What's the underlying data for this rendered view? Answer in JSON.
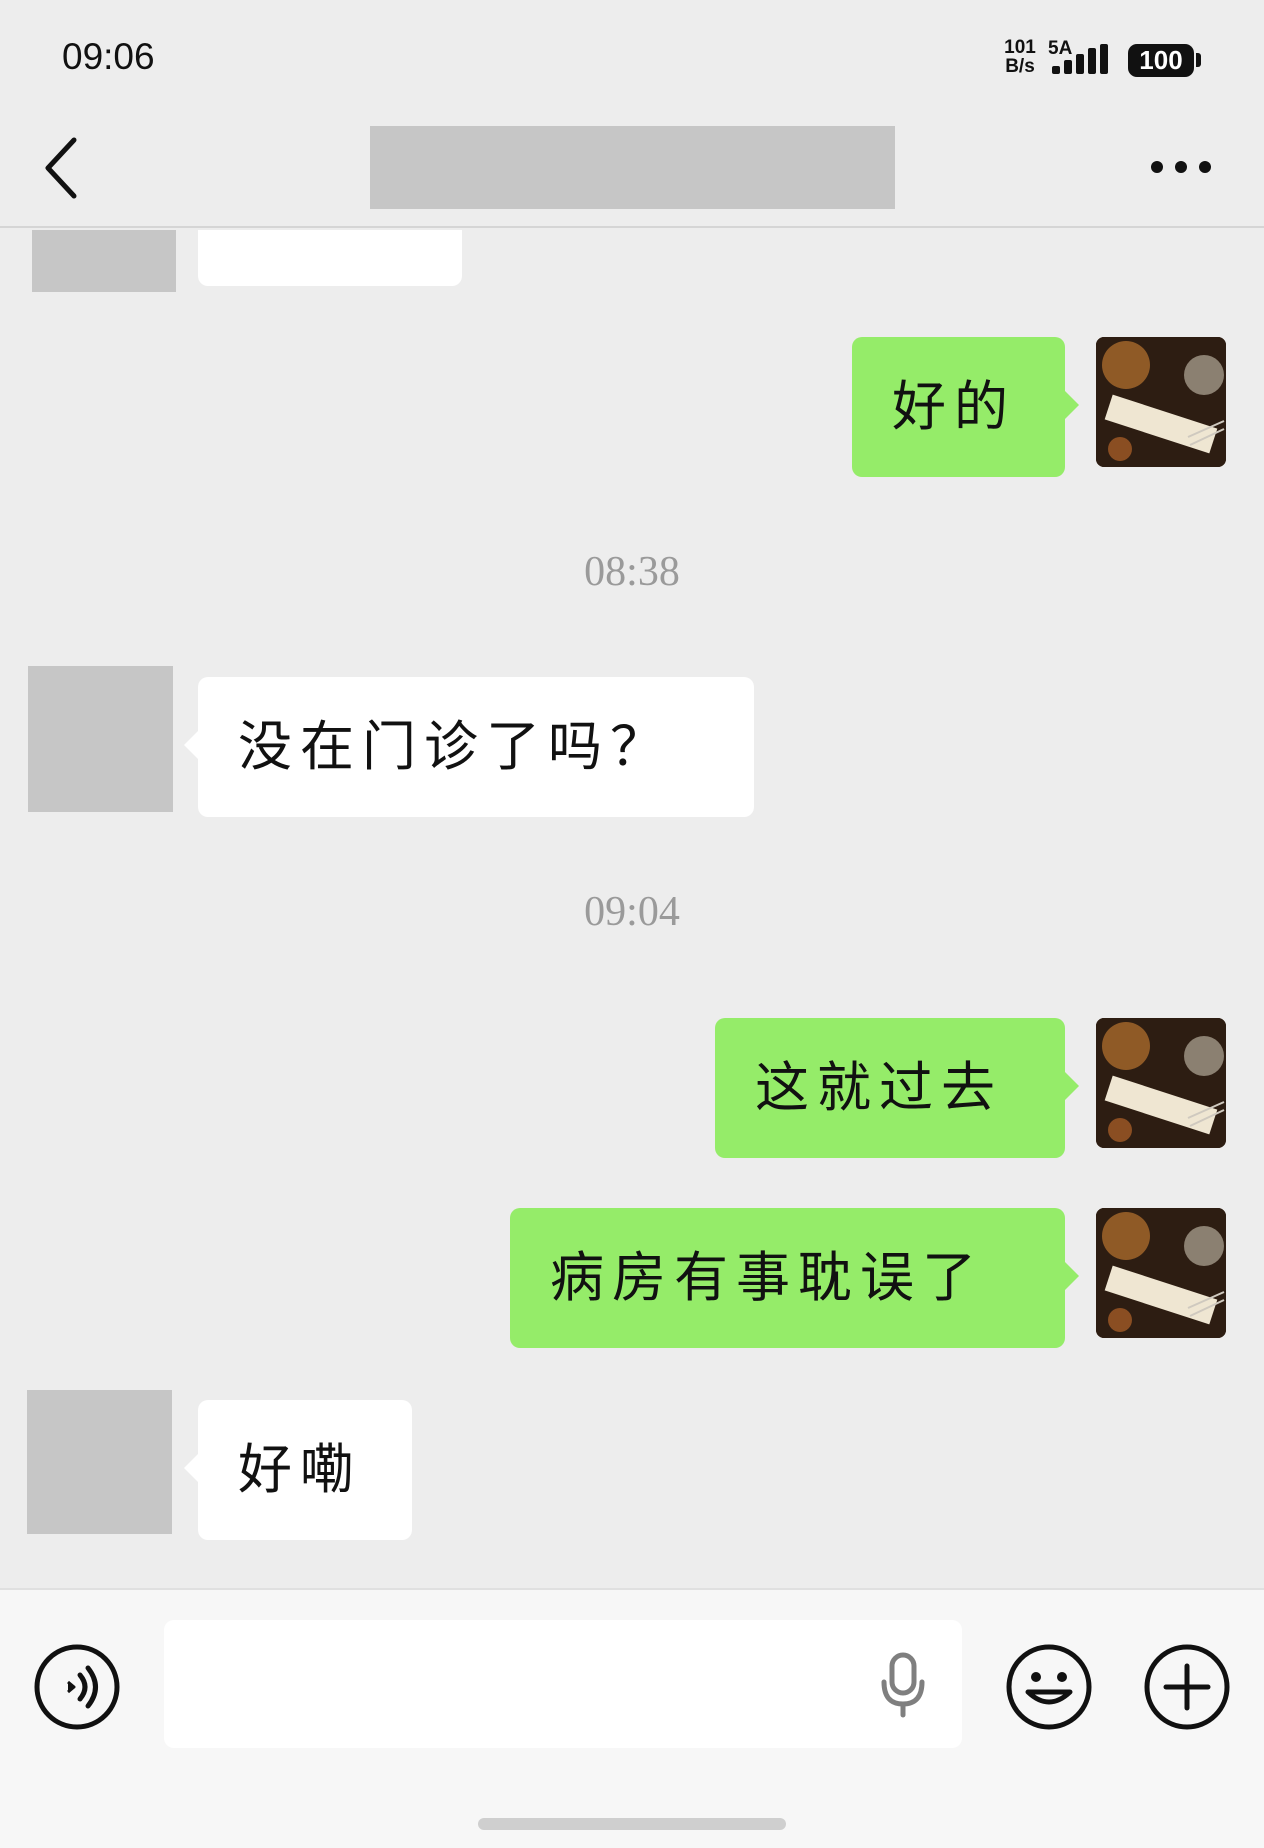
{
  "status_bar": {
    "time": "09:06",
    "net_speed_value": "101",
    "net_speed_unit": "B/s",
    "network": "5A",
    "battery": "100"
  },
  "nav": {
    "back_icon": "chevron-left-icon",
    "more_icon": "more-dots-icon",
    "title": ""
  },
  "messages": [
    {
      "side": "in",
      "text": ""
    },
    {
      "side": "out",
      "text": "好的"
    },
    {
      "type": "timestamp",
      "text": "08:38"
    },
    {
      "side": "in",
      "text": "没在门诊了吗？"
    },
    {
      "type": "timestamp",
      "text": "09:04"
    },
    {
      "side": "out",
      "text": "这就过去"
    },
    {
      "side": "out",
      "text": "病房有事耽误了"
    },
    {
      "side": "in",
      "text": "好嘞"
    }
  ],
  "input_bar": {
    "voice_icon": "voice-toggle-icon",
    "placeholder": "",
    "mic_icon": "microphone-icon",
    "emoji_icon": "emoji-icon",
    "plus_icon": "plus-icon"
  },
  "colors": {
    "background": "#ededed",
    "outgoing_bubble": "#95ec69",
    "incoming_bubble": "#ffffff",
    "timestamp": "#9a9a9a",
    "placeholder_block": "#c6c6c6"
  }
}
